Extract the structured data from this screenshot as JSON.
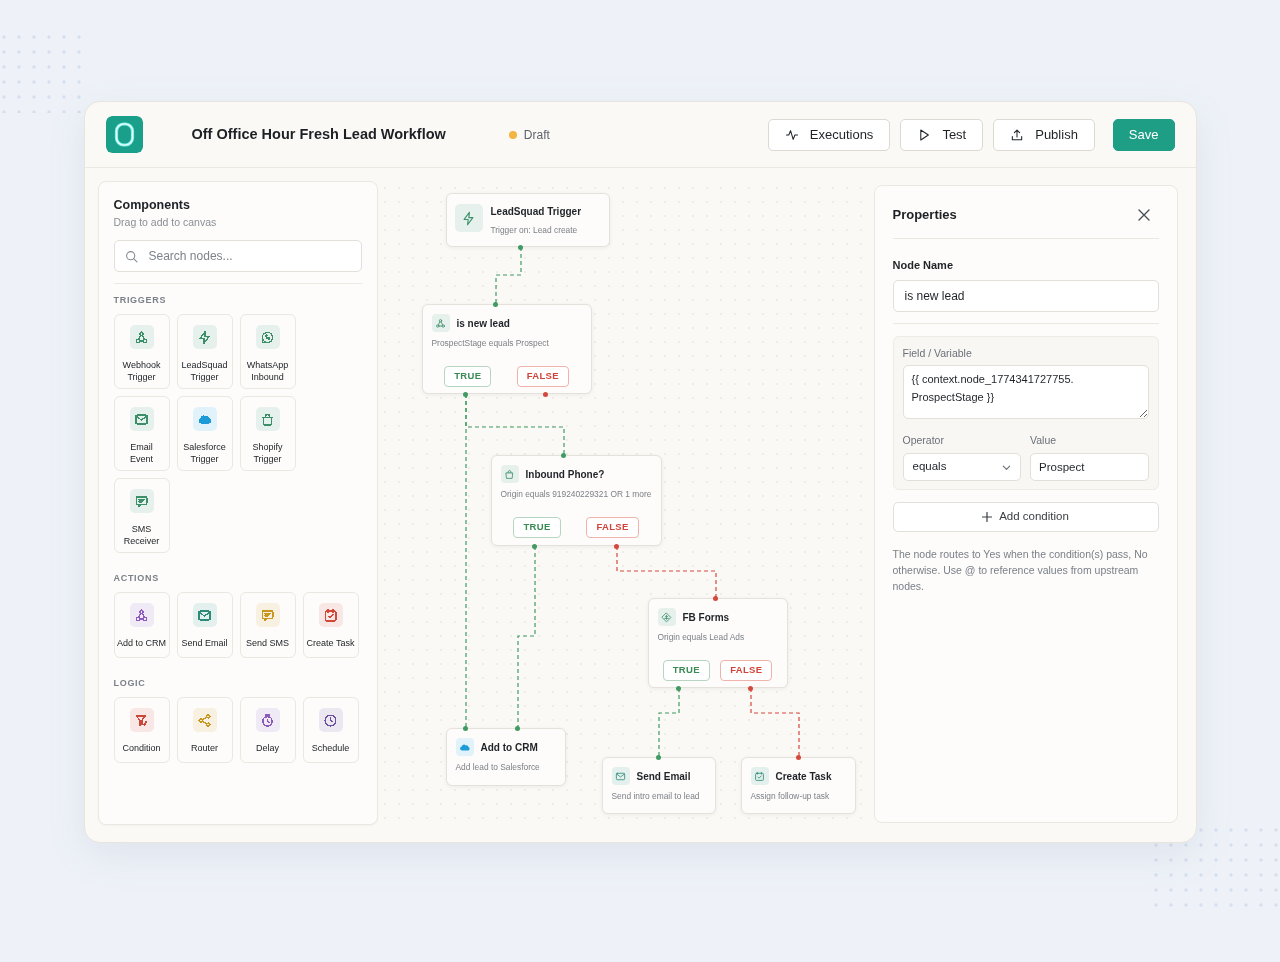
{
  "header": {
    "title": "Off Office Hour Fresh Lead Workflow",
    "status": {
      "label": "Draft",
      "color": "#f2b443"
    },
    "actions": [
      {
        "label": "Executions",
        "kind": "outline"
      },
      {
        "label": "Test",
        "kind": "outline"
      },
      {
        "label": "Publish",
        "kind": "outline"
      },
      {
        "label": "Save",
        "kind": "primary"
      }
    ]
  },
  "components": {
    "title": "Components",
    "subtitle": "Drag to add to canvas",
    "search": {
      "placeholder": "Search nodes..."
    },
    "sections": [
      {
        "heading": "TRIGGERS",
        "items": [
          {
            "label": "Webhook Trigger",
            "kind": "webhook",
            "color": "#3d8f6a"
          },
          {
            "label": "LeadSquad Trigger",
            "kind": "bolt",
            "color": "#3d8f6a"
          },
          {
            "label": "WhatsApp Inbound",
            "kind": "whatsapp",
            "color": "#3d8f6a"
          },
          {
            "label": "Email Event",
            "kind": "mail",
            "color": "#3d8f6a"
          },
          {
            "label": "Salesforce Trigger",
            "kind": "cloud",
            "color": "#1d9bd8"
          },
          {
            "label": "Shopify Trigger",
            "kind": "bag",
            "color": "#3d8f6a"
          },
          {
            "label": "SMS Receiver",
            "kind": "sms",
            "color": "#3d8f6a"
          }
        ]
      },
      {
        "heading": "ACTIONS",
        "items": [
          {
            "label": "Add to CRM",
            "kind": "webhook",
            "color": "#8e5bbf"
          },
          {
            "label": "Send Email",
            "kind": "mail",
            "color": "#2f8a78"
          },
          {
            "label": "Send SMS",
            "kind": "sms",
            "color": "#c9971f"
          },
          {
            "label": "Create Task",
            "kind": "task",
            "color": "#d2493a"
          }
        ]
      },
      {
        "heading": "LOGIC",
        "items": [
          {
            "label": "Condition",
            "kind": "filter",
            "color": "#c9483a"
          },
          {
            "label": "Router",
            "kind": "share",
            "color": "#c9971f"
          },
          {
            "label": "Delay",
            "kind": "timer",
            "color": "#8a5bb8"
          },
          {
            "label": "Schedule",
            "kind": "clock",
            "color": "#6b4f9a"
          }
        ]
      }
    ]
  },
  "canvas": {
    "nodes": [
      {
        "kind": "trigger",
        "title": "LeadSquad Trigger",
        "description": "Trigger on: Lead create"
      },
      {
        "kind": "condition",
        "title": "is new lead",
        "description": "ProspectStage equals Prospect",
        "true_label": "TRUE",
        "false_label": "FALSE"
      },
      {
        "kind": "condition",
        "title": "Inbound Phone?",
        "description": "Origin equals 919240229321 OR 1 more",
        "true_label": "TRUE",
        "false_label": "FALSE"
      },
      {
        "kind": "condition",
        "title": "FB Forms",
        "description": "Origin equals Lead Ads",
        "true_label": "TRUE",
        "false_label": "FALSE"
      },
      {
        "kind": "action",
        "title": "Add to CRM",
        "description": "Add lead to Salesforce"
      },
      {
        "kind": "action",
        "title": "Send Email",
        "description": "Send intro email to lead"
      },
      {
        "kind": "action",
        "title": "Create Task",
        "description": "Assign follow-up task"
      }
    ],
    "edges": [
      {
        "kind": "next"
      },
      {
        "kind": "true"
      },
      {
        "kind": "true"
      },
      {
        "kind": "true"
      },
      {
        "kind": "false"
      },
      {
        "kind": "true"
      },
      {
        "kind": "false"
      }
    ]
  },
  "properties": {
    "title": "Properties",
    "node_name": {
      "label": "Node Name",
      "value": "is new lead"
    },
    "condition": {
      "field_label": "Field / Variable",
      "field_value": "{{ context.node_1774341727755.\nProspectStage }}",
      "operator_label": "Operator",
      "operator": "equals",
      "value_label": "Value",
      "value": "Prospect"
    },
    "add_button": "Add condition",
    "help": "The node routes to Yes when the condition(s) pass, No otherwise. Use @ to reference values from upstream nodes."
  }
}
